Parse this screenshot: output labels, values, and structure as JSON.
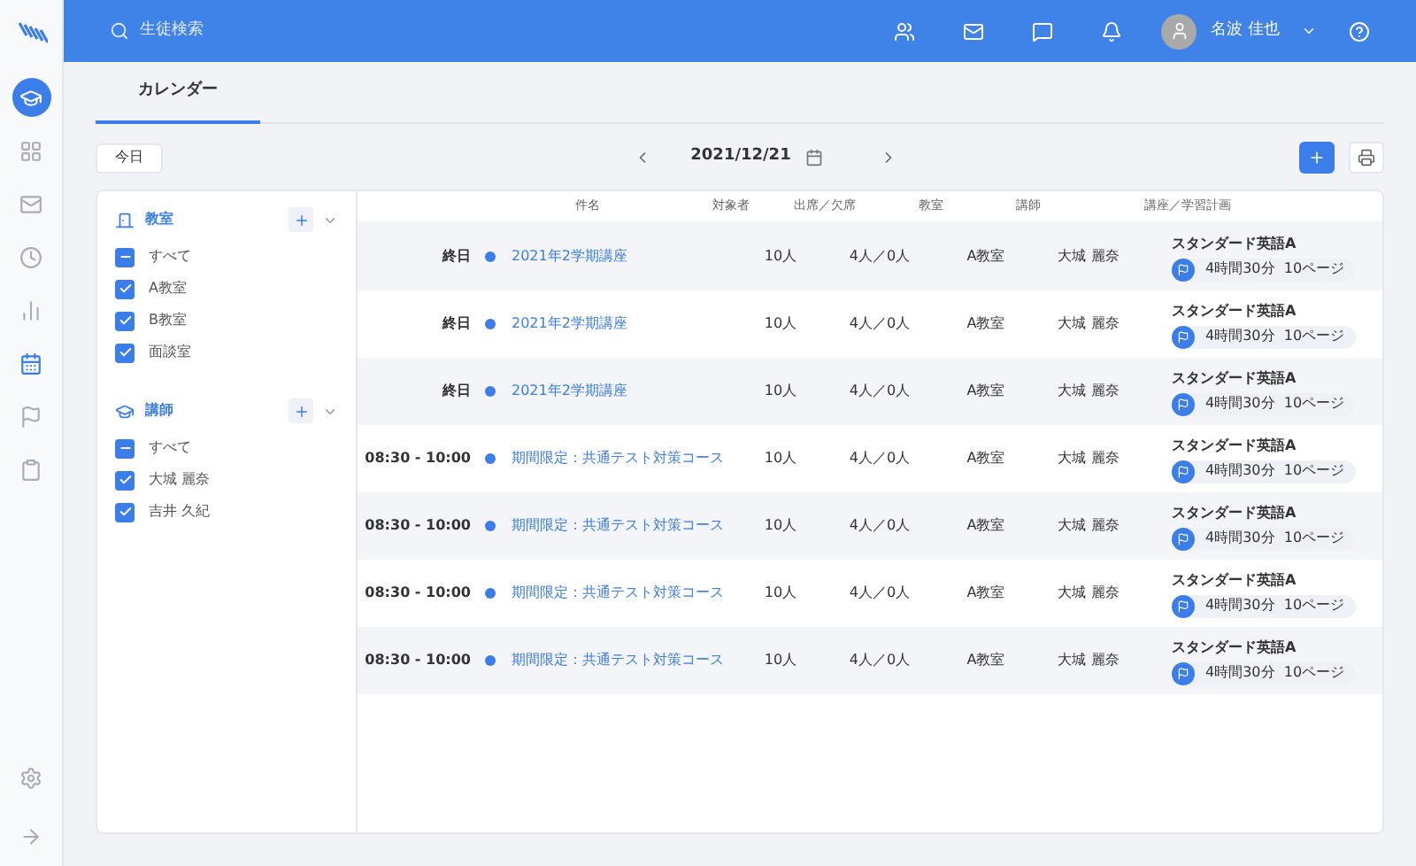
{
  "sidebar": {
    "items": [
      {
        "selected": true,
        "highlighted": false
      },
      {
        "selected": false,
        "highlighted": false
      },
      {
        "selected": false,
        "highlighted": false
      },
      {
        "selected": false,
        "highlighted": false
      },
      {
        "selected": false,
        "highlighted": false
      },
      {
        "selected": false,
        "highlighted": true
      },
      {
        "selected": false,
        "highlighted": false
      },
      {
        "selected": false,
        "highlighted": false
      }
    ]
  },
  "header": {
    "search": {
      "placeholder": "生徒検索"
    },
    "user_name": "名波 佳也"
  },
  "tabs": [
    {
      "label": "カレンダー",
      "selected": true
    }
  ],
  "toolbar": {
    "today": "今日",
    "date": "2021/12/21"
  },
  "filters": [
    {
      "title": "教室",
      "items": [
        {
          "label": "すべて",
          "checked": true,
          "partial": true
        },
        {
          "label": "A教室",
          "checked": true
        },
        {
          "label": "B教室",
          "checked": true
        },
        {
          "label": "面談室",
          "checked": true
        }
      ]
    },
    {
      "title": "講師",
      "items": [
        {
          "label": "すべて",
          "checked": true,
          "partial": true
        },
        {
          "label": "大城 麗奈",
          "checked": true
        },
        {
          "label": "吉井 久紀",
          "checked": true
        }
      ]
    }
  ],
  "table": {
    "columns": [
      "件名",
      "対象者",
      "出席／欠席",
      "教室",
      "講師",
      "講座／学習計画"
    ],
    "rows": [
      {
        "time": "終日",
        "color": "#3b7de9",
        "title": "2021年2学期講座",
        "target": "10人",
        "attendance": "4人／0人",
        "room": "A教室",
        "teacher": "大城 麗奈",
        "course": "スタンダード英語A",
        "plan": "4時間30分  10ページ"
      },
      {
        "time": "終日",
        "color": "#3b7de9",
        "title": "2021年2学期講座",
        "target": "10人",
        "attendance": "4人／0人",
        "room": "A教室",
        "teacher": "大城 麗奈",
        "course": "スタンダード英語A",
        "plan": "4時間30分  10ページ"
      },
      {
        "time": "終日",
        "color": "#3b7de9",
        "title": "2021年2学期講座",
        "target": "10人",
        "attendance": "4人／0人",
        "room": "A教室",
        "teacher": "大城 麗奈",
        "course": "スタンダード英語A",
        "plan": "4時間30分  10ページ"
      },
      {
        "time": "08:30 - 10:00",
        "color": "#3b7de9",
        "title": "期間限定：共通テスト対策コース",
        "target": "10人",
        "attendance": "4人／0人",
        "room": "A教室",
        "teacher": "大城 麗奈",
        "course": "スタンダード英語A",
        "plan": "4時間30分  10ページ"
      },
      {
        "time": "08:30 - 10:00",
        "color": "#3b7de9",
        "title": "期間限定：共通テスト対策コース",
        "target": "10人",
        "attendance": "4人／0人",
        "room": "A教室",
        "teacher": "大城 麗奈",
        "course": "スタンダード英語A",
        "plan": "4時間30分  10ページ"
      },
      {
        "time": "08:30 - 10:00",
        "color": "#3b7de9",
        "title": "期間限定：共通テスト対策コース",
        "target": "10人",
        "attendance": "4人／0人",
        "room": "A教室",
        "teacher": "大城 麗奈",
        "course": "スタンダード英語A",
        "plan": "4時間30分  10ページ"
      },
      {
        "time": "08:30 - 10:00",
        "color": "#3b7de9",
        "title": "期間限定：共通テスト対策コース",
        "target": "10人",
        "attendance": "4人／0人",
        "room": "A教室",
        "teacher": "大城 麗奈",
        "course": "スタンダード英語A",
        "plan": "4時間30分  10ページ"
      }
    ]
  }
}
